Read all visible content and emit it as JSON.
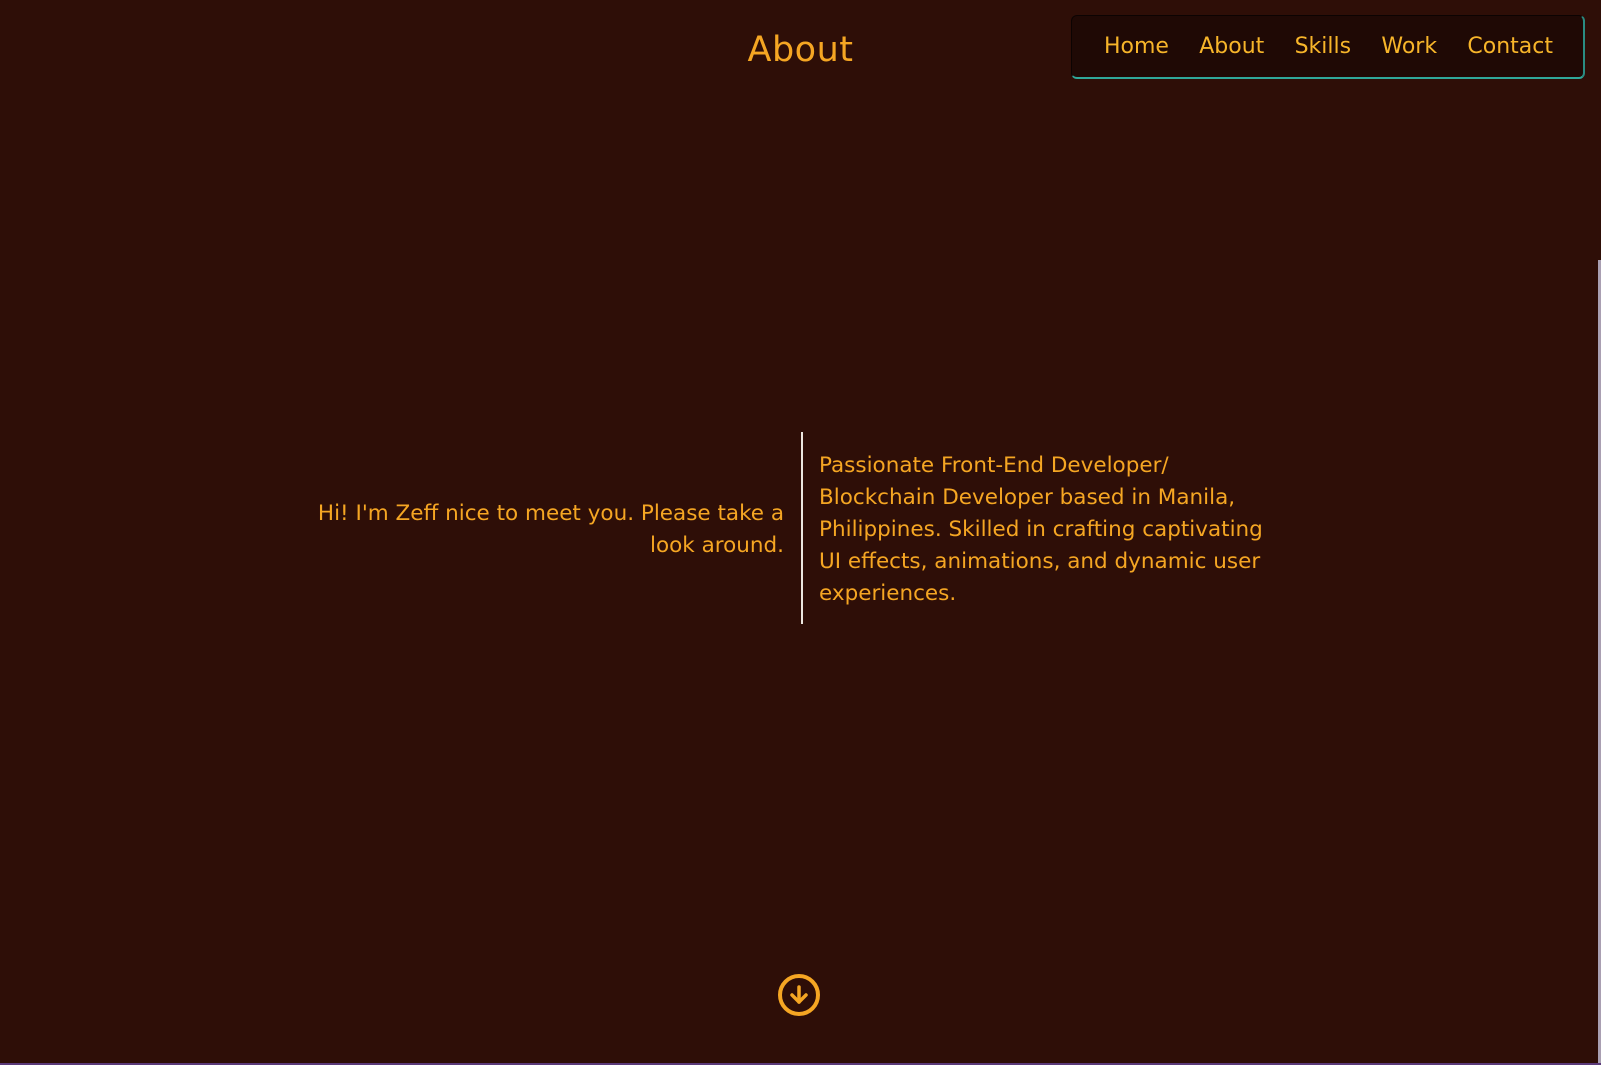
{
  "page": {
    "title": "About"
  },
  "nav": {
    "items": [
      {
        "label": "Home"
      },
      {
        "label": "About"
      },
      {
        "label": "Skills"
      },
      {
        "label": "Work"
      },
      {
        "label": "Contact"
      }
    ]
  },
  "intro": {
    "greeting": "Hi! I'm Zeff nice to meet you. Please take a look around.",
    "bio": "Passionate Front-End Developer/ Blockchain Developer based in Manila, Philippines. Skilled in crafting captivating UI effects, animations, and dynamic user experiences."
  },
  "icons": {
    "scroll_down": "arrow-down-circle-icon"
  },
  "colors": {
    "background": "#2e0e07",
    "accent": "#f5a623",
    "nav_background": "#1f0905",
    "nav_border": "#2fa89a",
    "divider": "#ece6df"
  }
}
